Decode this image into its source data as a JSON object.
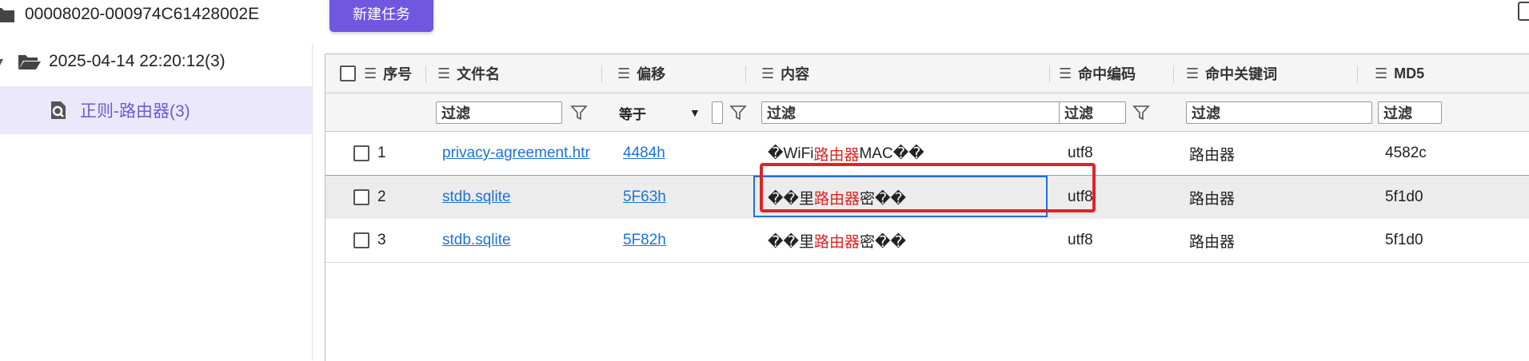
{
  "tree": {
    "items": [
      {
        "label": "00008020-000974C61428002E"
      },
      {
        "label": "2025-04-14 22:20:12(3)"
      },
      {
        "label": "正则-路由器(3)"
      }
    ]
  },
  "toolbar": {
    "new_task_label": "新建任务"
  },
  "grid": {
    "columns": [
      {
        "label": "序号"
      },
      {
        "label": "文件名"
      },
      {
        "label": "偏移"
      },
      {
        "label": "内容"
      },
      {
        "label": "命中编码"
      },
      {
        "label": "命中关键词"
      },
      {
        "label": "MD5"
      }
    ],
    "filter_placeholder": "过滤",
    "offset_operator": "等于",
    "rows": [
      {
        "index": "1",
        "file": "privacy-agreement.htr",
        "offset": "4484h",
        "content_pre": "�WiFi",
        "content_hit": "路由器",
        "content_post": "MAC��",
        "encoding": "utf8",
        "keyword": "路由器",
        "md5": "4582c"
      },
      {
        "index": "2",
        "file": "stdb.sqlite",
        "offset": "5F63h",
        "content_pre": "��里",
        "content_hit": "路由器",
        "content_post": "密��",
        "encoding": "utf8",
        "keyword": "路由器",
        "md5": "5f1d0"
      },
      {
        "index": "3",
        "file": "stdb.sqlite",
        "offset": "5F82h",
        "content_pre": "��里",
        "content_hit": "路由器",
        "content_post": "密��",
        "encoding": "utf8",
        "keyword": "路由器",
        "md5": "5f1d0"
      }
    ]
  },
  "colors": {
    "accent": "#6f57e0",
    "selected_bg": "#ece8fb",
    "link": "#1a73d9",
    "highlight": "#e02020",
    "annotation": "#e02424"
  }
}
